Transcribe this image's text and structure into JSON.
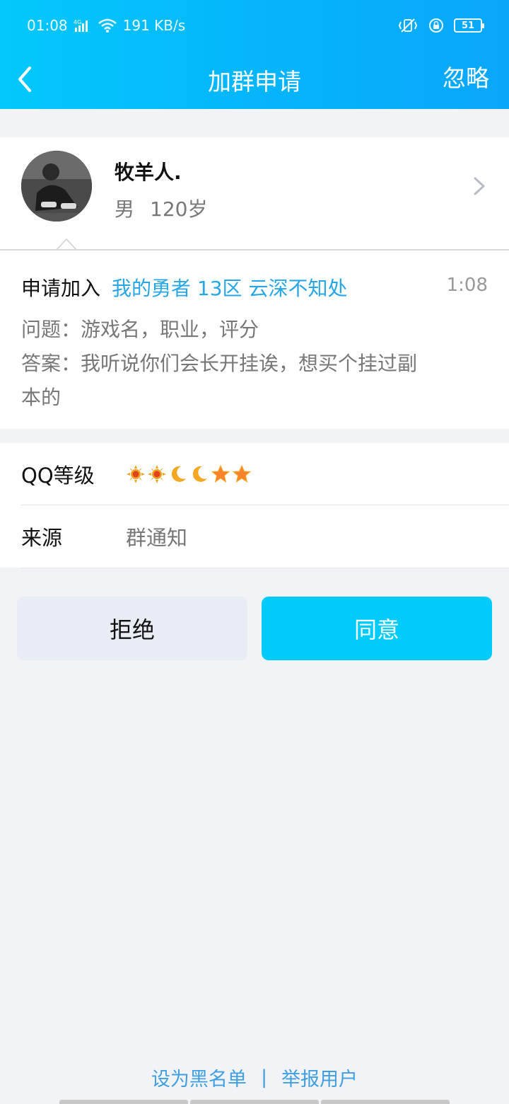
{
  "status_bar": {
    "time": "01:08",
    "network": "4G",
    "speed": "191 KB/s",
    "battery": "51"
  },
  "header": {
    "title": "加群申请",
    "ignore_label": "忽略"
  },
  "profile": {
    "name": "牧羊人.",
    "gender": "男",
    "age": "120岁"
  },
  "request": {
    "prefix": "申请加入",
    "group_name": "我的勇者 13区 云深不知处",
    "time": "1:08",
    "question": "问题：游戏名，职业，评分",
    "answer": "答案：我听说你们会长开挂诶，想买个挂过副本的"
  },
  "info": {
    "level_label": "QQ等级",
    "level_icons": [
      "sun-icon",
      "sun-icon",
      "moon-icon",
      "moon-icon",
      "star-icon",
      "star-icon"
    ],
    "source_label": "来源",
    "source_value": "群通知"
  },
  "actions": {
    "reject_label": "拒绝",
    "accept_label": "同意"
  },
  "footer": {
    "blacklist_label": "设为黑名单",
    "separator": "|",
    "report_label": "举报用户"
  },
  "colors": {
    "header_gradient_start": "#03c8fb",
    "header_gradient_end": "#0aa6fa",
    "accept_button": "#00cbfb",
    "reject_button": "#e8ecf4",
    "link_blue": "#26a6e6"
  }
}
